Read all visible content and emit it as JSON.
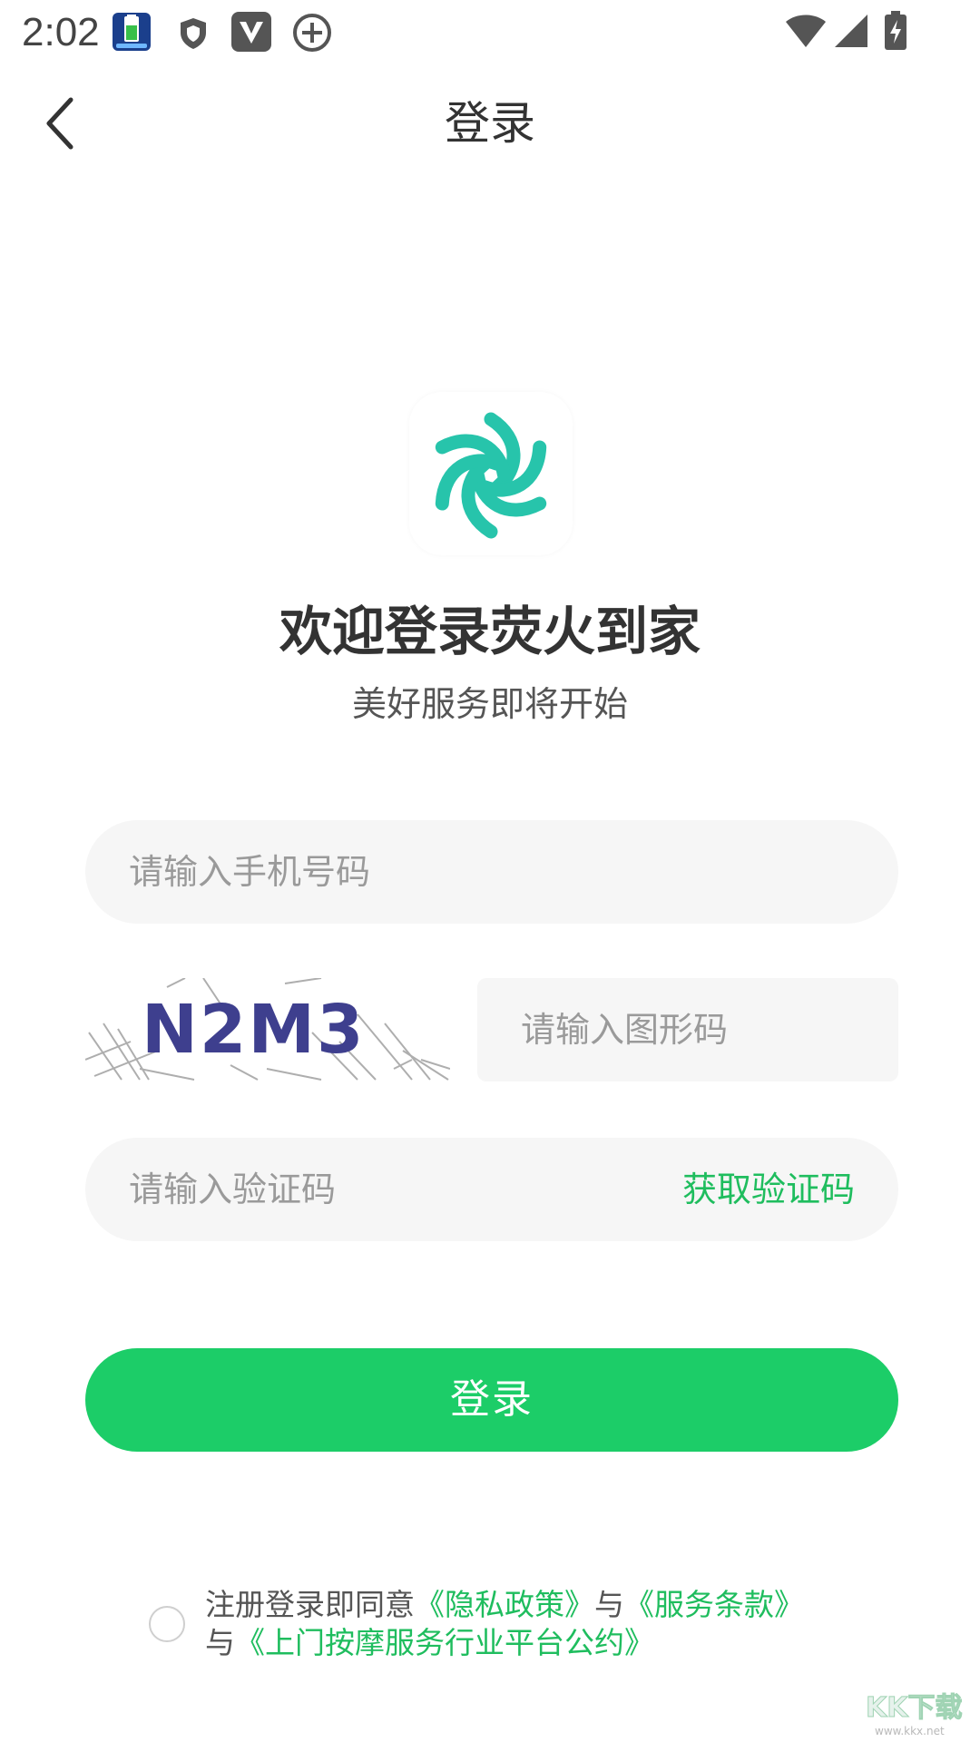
{
  "status_bar": {
    "time": "2:02",
    "icons": [
      "battery-app-icon",
      "shield-icon",
      "v-app-icon",
      "add-circle-icon",
      "wifi-icon",
      "signal-icon",
      "battery-charging-icon"
    ]
  },
  "navbar": {
    "back_icon": "chevron-left-icon",
    "title": "登录"
  },
  "logo": {
    "icon": "flower-logo-icon",
    "color": "#27c4ab"
  },
  "welcome": {
    "title": "欢迎登录荧火到家",
    "subtitle": "美好服务即将开始"
  },
  "form": {
    "phone": {
      "value": "",
      "placeholder": "请输入手机号码"
    },
    "captcha": {
      "image_text": "N2M3",
      "value": "",
      "placeholder": "请输入图形码"
    },
    "sms_code": {
      "value": "",
      "placeholder": "请输入验证码",
      "get_code_label": "获取验证码"
    },
    "submit_label": "登录"
  },
  "agreement": {
    "checked": false,
    "prefix": "注册登录即同意",
    "privacy_link": "《隐私政策》",
    "and1": "与",
    "terms_link": "《服务条款》",
    "and2": "与",
    "convention_link": "《上门按摩服务行业平台公约》"
  },
  "colors": {
    "accent_green": "#1ccd68",
    "link_green": "#1fbd5e",
    "logo_teal": "#27c4ab",
    "input_bg": "#f6f6f6"
  },
  "watermark": {
    "text": "KK下载",
    "url_text": "www.kkx.net"
  }
}
